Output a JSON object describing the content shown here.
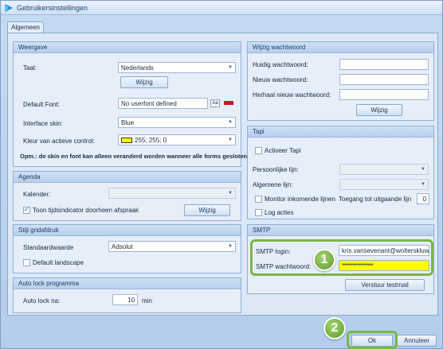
{
  "window": {
    "title": "Gebruikersinstellingen",
    "close_glyph": "✕"
  },
  "tabs": [
    {
      "label": "Algemeen"
    }
  ],
  "weergave": {
    "header": "Weergave",
    "taal_label": "Taal:",
    "taal_value": "Nederlands",
    "taal_button": "Wijzig",
    "font_label": "Default Font:",
    "font_value": "No userfont defined",
    "font_aa_glyph": "Aa",
    "skin_label": "Interface skin:",
    "skin_value": "Blue",
    "kleur_label": "Kleur van actieve control:",
    "kleur_value": "255; 255; 0",
    "note": "Opm.: de skin en font kan alleen veranderd worden wanneer alle forms gesloten"
  },
  "agenda": {
    "header": "Agenda",
    "kalender_label": "Kalender:",
    "kalender_value": "",
    "tijdsindicator_label": "Toon tijdsindicator doorheen afspraak",
    "tijdsindicator_checked": true,
    "button": "Wijzig"
  },
  "gridafdruk": {
    "header": "Stijl gridafdruk",
    "standaard_label": "Standaardwaarde",
    "standaard_value": "Adsolut",
    "landscape_label": "Default landscape",
    "landscape_checked": false
  },
  "autolock": {
    "header": "Auto lock programma",
    "label": "Auto lock na:",
    "value": "10",
    "unit": "min"
  },
  "wachtwoord": {
    "header": "Wijzig wachtwoord",
    "huidig_label": "Huidig wachtwoord:",
    "nieuw_label": "Nieuw wachtwoord:",
    "herhaal_label": "Herhaal nieuw wachtwoord:",
    "button": "Wijzig"
  },
  "tapi": {
    "header": "Tapi",
    "activeer_label": "Activeer Tapi",
    "persoonlijke_label": "Persoonlijke lijn:",
    "algemene_label": "Algemene lijn:",
    "monitor_label": "Monitor inkomende lijnen",
    "toegang_label": "Toegang tot uitgaande lijn",
    "toegang_value": "0",
    "log_label": "Log acties"
  },
  "smtp": {
    "header": "SMTP",
    "login_label": "SMTP login:",
    "login_value": "kris.vansevenant@wolterskluw",
    "ww_label": "SMTP wachtwoord:",
    "ww_value": "***************",
    "button": "Verstuur testmail"
  },
  "footer": {
    "ok": "Ok",
    "annuleer": "Annuleer"
  },
  "callouts": {
    "one": "1",
    "two": "2"
  },
  "colors": {
    "highlight_yellow": "#ffff00",
    "callout_green": "#7ab648"
  }
}
